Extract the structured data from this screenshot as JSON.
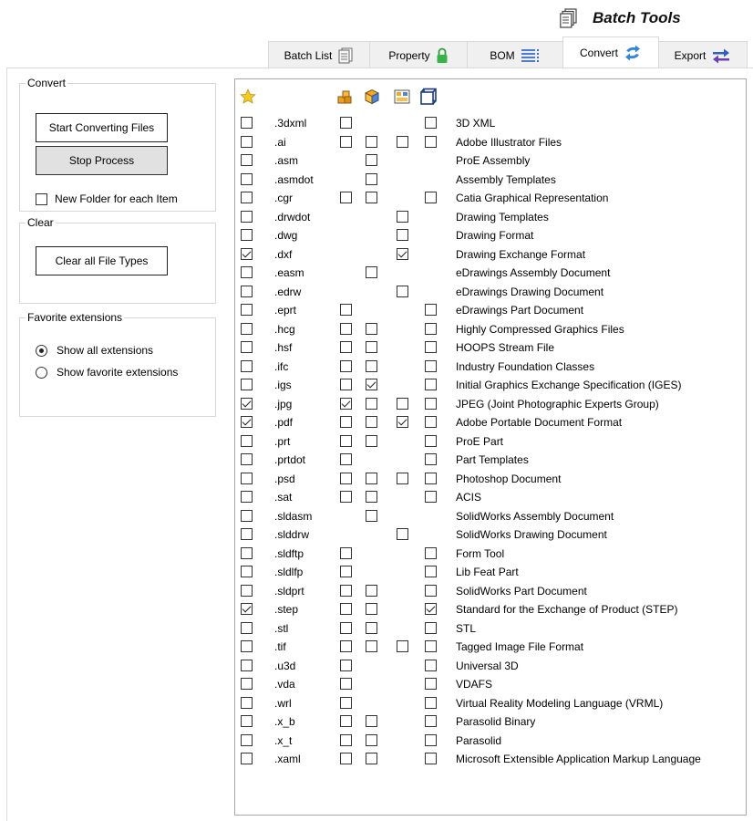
{
  "header": {
    "title": "Batch Tools",
    "icon": "batch-tools-icon"
  },
  "tabs": [
    {
      "label": "Batch List",
      "icon": "batch-list-icon",
      "active": false
    },
    {
      "label": "Property",
      "icon": "lock-icon",
      "active": false
    },
    {
      "label": "BOM",
      "icon": "list-lines-icon",
      "active": false
    },
    {
      "label": "Convert",
      "icon": "convert-arrows-icon",
      "active": true
    },
    {
      "label": "Export",
      "icon": "export-arrows-icon",
      "active": false
    }
  ],
  "convert_group": {
    "title": "Convert",
    "start_label": "Start Converting Files",
    "stop_label": "Stop Process",
    "new_folder_label": "New Folder for each Item",
    "new_folder_checked": false
  },
  "clear_group": {
    "title": "Clear",
    "clear_label": "Clear all File Types"
  },
  "favorites_group": {
    "title": "Favorite extensions",
    "options": [
      {
        "label": "Show all extensions",
        "selected": true
      },
      {
        "label": "Show favorite extensions",
        "selected": false
      }
    ]
  },
  "column_icons": [
    "favorite-star-icon",
    "assembly-icon",
    "part-icon",
    "drawing-icon",
    "3d-box-icon"
  ],
  "file_types": [
    {
      "fav": false,
      "ext": ".3dxml",
      "c": [
        false,
        null,
        null,
        false
      ],
      "desc": "3D XML"
    },
    {
      "fav": false,
      "ext": ".ai",
      "c": [
        false,
        false,
        false,
        false
      ],
      "desc": "Adobe Illustrator Files"
    },
    {
      "fav": false,
      "ext": ".asm",
      "c": [
        null,
        false,
        null,
        null
      ],
      "desc": "ProE Assembly"
    },
    {
      "fav": false,
      "ext": ".asmdot",
      "c": [
        null,
        false,
        null,
        null
      ],
      "desc": "Assembly Templates"
    },
    {
      "fav": false,
      "ext": ".cgr",
      "c": [
        false,
        false,
        null,
        false
      ],
      "desc": "Catia Graphical Representation"
    },
    {
      "fav": false,
      "ext": ".drwdot",
      "c": [
        null,
        null,
        false,
        null
      ],
      "desc": "Drawing Templates"
    },
    {
      "fav": false,
      "ext": ".dwg",
      "c": [
        null,
        null,
        false,
        null
      ],
      "desc": "Drawing Format"
    },
    {
      "fav": true,
      "ext": ".dxf",
      "c": [
        null,
        null,
        true,
        null
      ],
      "desc": "Drawing Exchange Format"
    },
    {
      "fav": false,
      "ext": ".easm",
      "c": [
        null,
        false,
        null,
        null
      ],
      "desc": "eDrawings Assembly Document"
    },
    {
      "fav": false,
      "ext": ".edrw",
      "c": [
        null,
        null,
        false,
        null
      ],
      "desc": "eDrawings Drawing Document"
    },
    {
      "fav": false,
      "ext": ".eprt",
      "c": [
        false,
        null,
        null,
        false
      ],
      "desc": "eDrawings Part Document"
    },
    {
      "fav": false,
      "ext": ".hcg",
      "c": [
        false,
        false,
        null,
        false
      ],
      "desc": "Highly Compressed Graphics Files"
    },
    {
      "fav": false,
      "ext": ".hsf",
      "c": [
        false,
        false,
        null,
        false
      ],
      "desc": "HOOPS Stream File"
    },
    {
      "fav": false,
      "ext": ".ifc",
      "c": [
        false,
        false,
        null,
        false
      ],
      "desc": "Industry Foundation Classes"
    },
    {
      "fav": false,
      "ext": ".igs",
      "c": [
        false,
        true,
        null,
        false
      ],
      "desc": "Initial Graphics Exchange Specification (IGES)"
    },
    {
      "fav": true,
      "ext": ".jpg",
      "c": [
        true,
        false,
        false,
        false
      ],
      "desc": "JPEG (Joint Photographic Experts Group)"
    },
    {
      "fav": true,
      "ext": ".pdf",
      "c": [
        false,
        false,
        true,
        false
      ],
      "desc": "Adobe Portable Document Format"
    },
    {
      "fav": false,
      "ext": ".prt",
      "c": [
        false,
        false,
        null,
        false
      ],
      "desc": "ProE Part"
    },
    {
      "fav": false,
      "ext": ".prtdot",
      "c": [
        false,
        null,
        null,
        false
      ],
      "desc": "Part Templates"
    },
    {
      "fav": false,
      "ext": ".psd",
      "c": [
        false,
        false,
        false,
        false
      ],
      "desc": "Photoshop Document"
    },
    {
      "fav": false,
      "ext": ".sat",
      "c": [
        false,
        false,
        null,
        false
      ],
      "desc": "ACIS"
    },
    {
      "fav": false,
      "ext": ".sldasm",
      "c": [
        null,
        false,
        null,
        null
      ],
      "desc": "SolidWorks Assembly Document"
    },
    {
      "fav": false,
      "ext": ".slddrw",
      "c": [
        null,
        null,
        false,
        null
      ],
      "desc": "SolidWorks Drawing Document"
    },
    {
      "fav": false,
      "ext": ".sldftp",
      "c": [
        false,
        null,
        null,
        false
      ],
      "desc": "Form Tool"
    },
    {
      "fav": false,
      "ext": ".sldlfp",
      "c": [
        false,
        null,
        null,
        false
      ],
      "desc": "Lib Feat Part"
    },
    {
      "fav": false,
      "ext": ".sldprt",
      "c": [
        false,
        false,
        null,
        false
      ],
      "desc": "SolidWorks Part Document"
    },
    {
      "fav": true,
      "ext": ".step",
      "c": [
        false,
        false,
        null,
        true
      ],
      "desc": "Standard for the Exchange of Product (STEP)"
    },
    {
      "fav": false,
      "ext": ".stl",
      "c": [
        false,
        false,
        null,
        false
      ],
      "desc": "STL"
    },
    {
      "fav": false,
      "ext": ".tif",
      "c": [
        false,
        false,
        false,
        false
      ],
      "desc": "Tagged Image File Format"
    },
    {
      "fav": false,
      "ext": ".u3d",
      "c": [
        false,
        null,
        null,
        false
      ],
      "desc": "Universal 3D"
    },
    {
      "fav": false,
      "ext": ".vda",
      "c": [
        false,
        null,
        null,
        false
      ],
      "desc": "VDAFS"
    },
    {
      "fav": false,
      "ext": ".wrl",
      "c": [
        false,
        null,
        null,
        false
      ],
      "desc": "Virtual Reality Modeling Language (VRML)"
    },
    {
      "fav": false,
      "ext": ".x_b",
      "c": [
        false,
        false,
        null,
        false
      ],
      "desc": "Parasolid Binary"
    },
    {
      "fav": false,
      "ext": ".x_t",
      "c": [
        false,
        false,
        null,
        false
      ],
      "desc": "Parasolid"
    },
    {
      "fav": false,
      "ext": ".xaml",
      "c": [
        false,
        false,
        null,
        false
      ],
      "desc": "Microsoft Extensible Application Markup Language"
    }
  ]
}
